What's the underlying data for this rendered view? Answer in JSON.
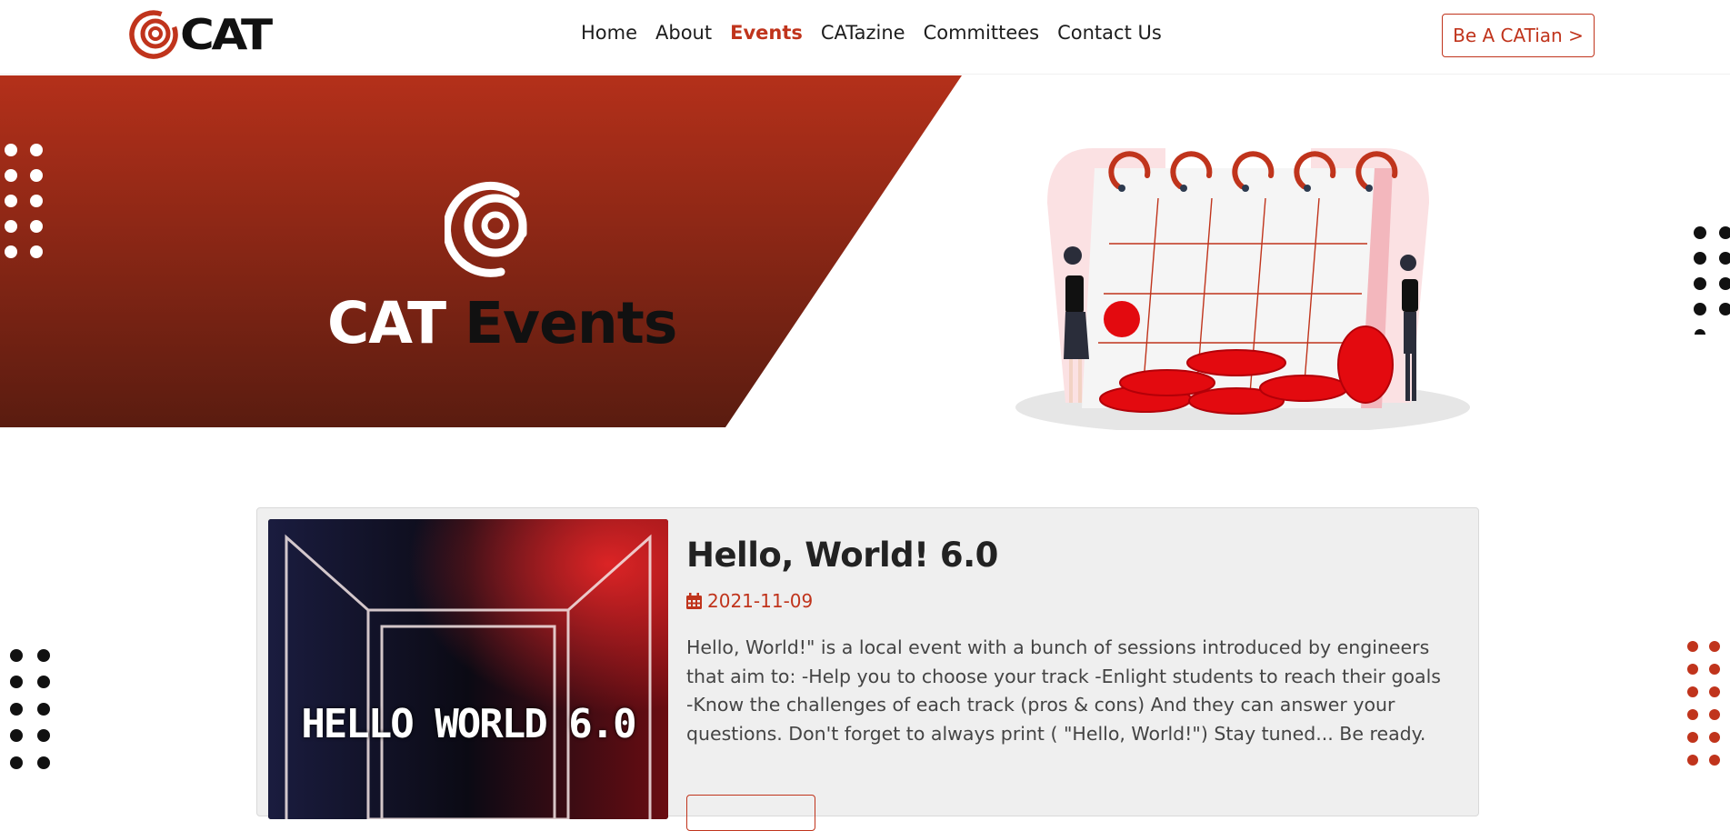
{
  "nav": {
    "brand": "CAT",
    "links": [
      "Home",
      "About",
      "Events",
      "CATazine",
      "Committees",
      "Contact Us"
    ],
    "active": "Events",
    "cta": "Be A CATian >"
  },
  "hero": {
    "title_white": "CAT",
    "title_dark": "Events"
  },
  "event": {
    "title": "Hello, World! 6.0",
    "date": "2021-11-09",
    "description": "Hello, World!\" is a local event with a bunch of sessions introduced by engineers that aim to: -Help you to choose your track -Enlight students to reach their goals -Know the challenges of each track (pros & cons) And they can answer your questions. Don't forget to always print ( \"Hello, World!\") Stay tuned... Be ready.",
    "image_text": "HELLO WORLD 6.0"
  },
  "colors": {
    "accent": "#c0341c",
    "hero_top": "#b4301a",
    "hero_bottom": "#5a1c10"
  }
}
